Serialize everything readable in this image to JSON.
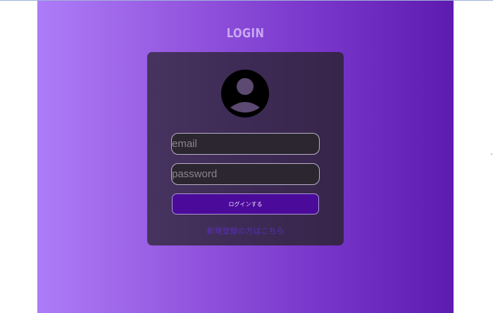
{
  "page": {
    "title": "LOGIN"
  },
  "icons": {
    "avatar": "user-avatar-icon"
  },
  "form": {
    "email_placeholder": "email",
    "password_placeholder": "password",
    "login_button_label": "ログインする",
    "signup_link_text": "新規登録の方はこちら"
  },
  "colors": {
    "gradient_start": "#ad7cf8",
    "gradient_end": "#5e1bb0",
    "card": "#3d2b55",
    "button": "#4b0a9a",
    "title": "#c9a9f3",
    "link": "#5a2fb6"
  }
}
